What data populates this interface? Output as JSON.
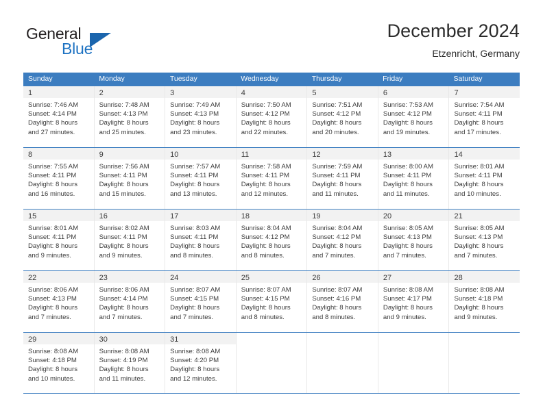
{
  "brand": {
    "name_top": "General",
    "name_bottom": "Blue",
    "triangle_icon": "triangle-icon",
    "color_dark": "#231f20",
    "color_blue": "#1d72c2"
  },
  "header": {
    "title": "December 2024",
    "subtitle": "Etzenricht, Germany"
  },
  "theme": {
    "header_blue": "#3c7dc0",
    "daynum_band": "#f2f2f2",
    "text": "#3b3b3b"
  },
  "weekdays": [
    "Sunday",
    "Monday",
    "Tuesday",
    "Wednesday",
    "Thursday",
    "Friday",
    "Saturday"
  ],
  "weeks": [
    {
      "days": [
        {
          "day": "1",
          "sunrise": "Sunrise: 7:46 AM",
          "sunset": "Sunset: 4:14 PM",
          "daylight1": "Daylight: 8 hours",
          "daylight2": "and 27 minutes."
        },
        {
          "day": "2",
          "sunrise": "Sunrise: 7:48 AM",
          "sunset": "Sunset: 4:13 PM",
          "daylight1": "Daylight: 8 hours",
          "daylight2": "and 25 minutes."
        },
        {
          "day": "3",
          "sunrise": "Sunrise: 7:49 AM",
          "sunset": "Sunset: 4:13 PM",
          "daylight1": "Daylight: 8 hours",
          "daylight2": "and 23 minutes."
        },
        {
          "day": "4",
          "sunrise": "Sunrise: 7:50 AM",
          "sunset": "Sunset: 4:12 PM",
          "daylight1": "Daylight: 8 hours",
          "daylight2": "and 22 minutes."
        },
        {
          "day": "5",
          "sunrise": "Sunrise: 7:51 AM",
          "sunset": "Sunset: 4:12 PM",
          "daylight1": "Daylight: 8 hours",
          "daylight2": "and 20 minutes."
        },
        {
          "day": "6",
          "sunrise": "Sunrise: 7:53 AM",
          "sunset": "Sunset: 4:12 PM",
          "daylight1": "Daylight: 8 hours",
          "daylight2": "and 19 minutes."
        },
        {
          "day": "7",
          "sunrise": "Sunrise: 7:54 AM",
          "sunset": "Sunset: 4:11 PM",
          "daylight1": "Daylight: 8 hours",
          "daylight2": "and 17 minutes."
        }
      ]
    },
    {
      "days": [
        {
          "day": "8",
          "sunrise": "Sunrise: 7:55 AM",
          "sunset": "Sunset: 4:11 PM",
          "daylight1": "Daylight: 8 hours",
          "daylight2": "and 16 minutes."
        },
        {
          "day": "9",
          "sunrise": "Sunrise: 7:56 AM",
          "sunset": "Sunset: 4:11 PM",
          "daylight1": "Daylight: 8 hours",
          "daylight2": "and 15 minutes."
        },
        {
          "day": "10",
          "sunrise": "Sunrise: 7:57 AM",
          "sunset": "Sunset: 4:11 PM",
          "daylight1": "Daylight: 8 hours",
          "daylight2": "and 13 minutes."
        },
        {
          "day": "11",
          "sunrise": "Sunrise: 7:58 AM",
          "sunset": "Sunset: 4:11 PM",
          "daylight1": "Daylight: 8 hours",
          "daylight2": "and 12 minutes."
        },
        {
          "day": "12",
          "sunrise": "Sunrise: 7:59 AM",
          "sunset": "Sunset: 4:11 PM",
          "daylight1": "Daylight: 8 hours",
          "daylight2": "and 11 minutes."
        },
        {
          "day": "13",
          "sunrise": "Sunrise: 8:00 AM",
          "sunset": "Sunset: 4:11 PM",
          "daylight1": "Daylight: 8 hours",
          "daylight2": "and 11 minutes."
        },
        {
          "day": "14",
          "sunrise": "Sunrise: 8:01 AM",
          "sunset": "Sunset: 4:11 PM",
          "daylight1": "Daylight: 8 hours",
          "daylight2": "and 10 minutes."
        }
      ]
    },
    {
      "days": [
        {
          "day": "15",
          "sunrise": "Sunrise: 8:01 AM",
          "sunset": "Sunset: 4:11 PM",
          "daylight1": "Daylight: 8 hours",
          "daylight2": "and 9 minutes."
        },
        {
          "day": "16",
          "sunrise": "Sunrise: 8:02 AM",
          "sunset": "Sunset: 4:11 PM",
          "daylight1": "Daylight: 8 hours",
          "daylight2": "and 9 minutes."
        },
        {
          "day": "17",
          "sunrise": "Sunrise: 8:03 AM",
          "sunset": "Sunset: 4:11 PM",
          "daylight1": "Daylight: 8 hours",
          "daylight2": "and 8 minutes."
        },
        {
          "day": "18",
          "sunrise": "Sunrise: 8:04 AM",
          "sunset": "Sunset: 4:12 PM",
          "daylight1": "Daylight: 8 hours",
          "daylight2": "and 8 minutes."
        },
        {
          "day": "19",
          "sunrise": "Sunrise: 8:04 AM",
          "sunset": "Sunset: 4:12 PM",
          "daylight1": "Daylight: 8 hours",
          "daylight2": "and 7 minutes."
        },
        {
          "day": "20",
          "sunrise": "Sunrise: 8:05 AM",
          "sunset": "Sunset: 4:13 PM",
          "daylight1": "Daylight: 8 hours",
          "daylight2": "and 7 minutes."
        },
        {
          "day": "21",
          "sunrise": "Sunrise: 8:05 AM",
          "sunset": "Sunset: 4:13 PM",
          "daylight1": "Daylight: 8 hours",
          "daylight2": "and 7 minutes."
        }
      ]
    },
    {
      "days": [
        {
          "day": "22",
          "sunrise": "Sunrise: 8:06 AM",
          "sunset": "Sunset: 4:13 PM",
          "daylight1": "Daylight: 8 hours",
          "daylight2": "and 7 minutes."
        },
        {
          "day": "23",
          "sunrise": "Sunrise: 8:06 AM",
          "sunset": "Sunset: 4:14 PM",
          "daylight1": "Daylight: 8 hours",
          "daylight2": "and 7 minutes."
        },
        {
          "day": "24",
          "sunrise": "Sunrise: 8:07 AM",
          "sunset": "Sunset: 4:15 PM",
          "daylight1": "Daylight: 8 hours",
          "daylight2": "and 7 minutes."
        },
        {
          "day": "25",
          "sunrise": "Sunrise: 8:07 AM",
          "sunset": "Sunset: 4:15 PM",
          "daylight1": "Daylight: 8 hours",
          "daylight2": "and 8 minutes."
        },
        {
          "day": "26",
          "sunrise": "Sunrise: 8:07 AM",
          "sunset": "Sunset: 4:16 PM",
          "daylight1": "Daylight: 8 hours",
          "daylight2": "and 8 minutes."
        },
        {
          "day": "27",
          "sunrise": "Sunrise: 8:08 AM",
          "sunset": "Sunset: 4:17 PM",
          "daylight1": "Daylight: 8 hours",
          "daylight2": "and 9 minutes."
        },
        {
          "day": "28",
          "sunrise": "Sunrise: 8:08 AM",
          "sunset": "Sunset: 4:18 PM",
          "daylight1": "Daylight: 8 hours",
          "daylight2": "and 9 minutes."
        }
      ]
    },
    {
      "days": [
        {
          "day": "29",
          "sunrise": "Sunrise: 8:08 AM",
          "sunset": "Sunset: 4:18 PM",
          "daylight1": "Daylight: 8 hours",
          "daylight2": "and 10 minutes."
        },
        {
          "day": "30",
          "sunrise": "Sunrise: 8:08 AM",
          "sunset": "Sunset: 4:19 PM",
          "daylight1": "Daylight: 8 hours",
          "daylight2": "and 11 minutes."
        },
        {
          "day": "31",
          "sunrise": "Sunrise: 8:08 AM",
          "sunset": "Sunset: 4:20 PM",
          "daylight1": "Daylight: 8 hours",
          "daylight2": "and 12 minutes."
        },
        {
          "day": "",
          "sunrise": "",
          "sunset": "",
          "daylight1": "",
          "daylight2": ""
        },
        {
          "day": "",
          "sunrise": "",
          "sunset": "",
          "daylight1": "",
          "daylight2": ""
        },
        {
          "day": "",
          "sunrise": "",
          "sunset": "",
          "daylight1": "",
          "daylight2": ""
        },
        {
          "day": "",
          "sunrise": "",
          "sunset": "",
          "daylight1": "",
          "daylight2": ""
        }
      ]
    }
  ]
}
